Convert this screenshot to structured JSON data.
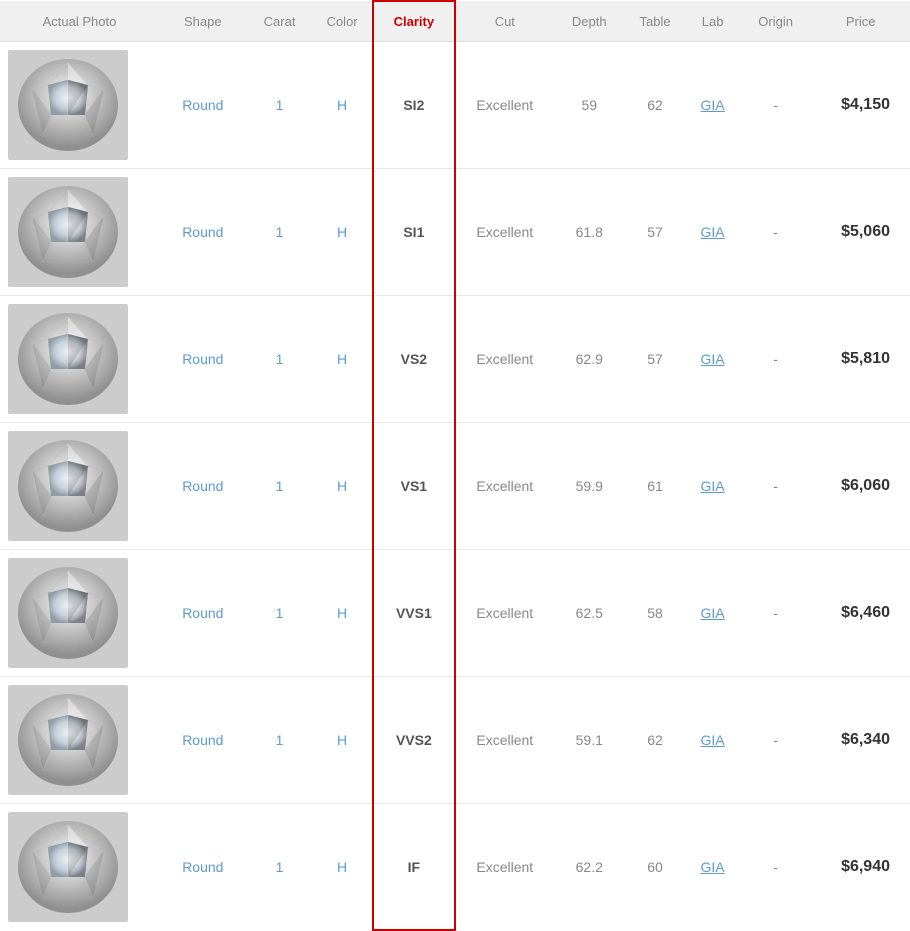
{
  "header": {
    "columns": [
      {
        "label": "Actual Photo",
        "key": "actual_photo"
      },
      {
        "label": "Shape",
        "key": "shape"
      },
      {
        "label": "Carat",
        "key": "carat"
      },
      {
        "label": "Color",
        "key": "color"
      },
      {
        "label": "Clarity",
        "key": "clarity"
      },
      {
        "label": "Cut",
        "key": "cut"
      },
      {
        "label": "Depth",
        "key": "depth"
      },
      {
        "label": "Table",
        "key": "table"
      },
      {
        "label": "Lab",
        "key": "lab"
      },
      {
        "label": "Origin",
        "key": "origin"
      },
      {
        "label": "Price",
        "key": "price"
      }
    ]
  },
  "rows": [
    {
      "shape": "Round",
      "carat": "1",
      "color": "H",
      "clarity": "SI2",
      "cut": "Excellent",
      "depth": "59",
      "table": "62",
      "lab": "GIA",
      "origin": "-",
      "price": "$4,150"
    },
    {
      "shape": "Round",
      "carat": "1",
      "color": "H",
      "clarity": "SI1",
      "cut": "Excellent",
      "depth": "61.8",
      "table": "57",
      "lab": "GIA",
      "origin": "-",
      "price": "$5,060"
    },
    {
      "shape": "Round",
      "carat": "1",
      "color": "H",
      "clarity": "VS2",
      "cut": "Excellent",
      "depth": "62.9",
      "table": "57",
      "lab": "GIA",
      "origin": "-",
      "price": "$5,810"
    },
    {
      "shape": "Round",
      "carat": "1",
      "color": "H",
      "clarity": "VS1",
      "cut": "Excellent",
      "depth": "59.9",
      "table": "61",
      "lab": "GIA",
      "origin": "-",
      "price": "$6,060"
    },
    {
      "shape": "Round",
      "carat": "1",
      "color": "H",
      "clarity": "VVS1",
      "cut": "Excellent",
      "depth": "62.5",
      "table": "58",
      "lab": "GIA",
      "origin": "-",
      "price": "$6,460"
    },
    {
      "shape": "Round",
      "carat": "1",
      "color": "H",
      "clarity": "VVS2",
      "cut": "Excellent",
      "depth": "59.1",
      "table": "62",
      "lab": "GIA",
      "origin": "-",
      "price": "$6,340"
    },
    {
      "shape": "Round",
      "carat": "1",
      "color": "H",
      "clarity": "IF",
      "cut": "Excellent",
      "depth": "62.2",
      "table": "60",
      "lab": "GIA",
      "origin": "-",
      "price": "$6,940"
    }
  ]
}
